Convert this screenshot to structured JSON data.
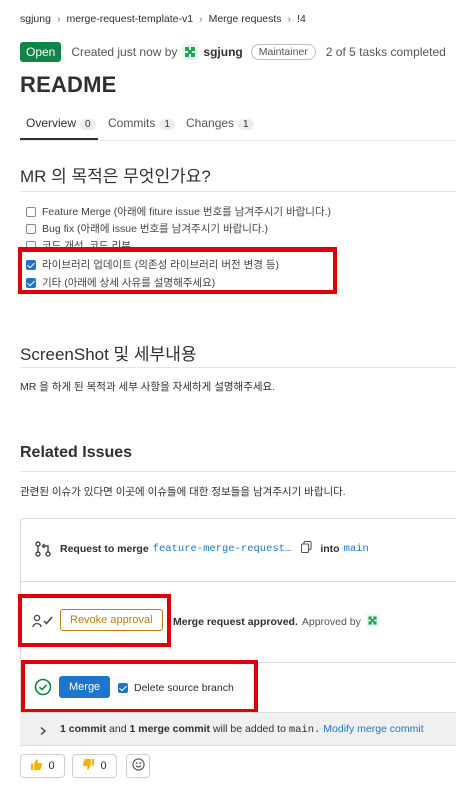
{
  "breadcrumb": {
    "items": [
      "sgjung",
      "merge-request-template-v1",
      "Merge requests",
      "!4"
    ],
    "separator": "›"
  },
  "status": {
    "badge": "Open",
    "created_text": "Created just now by",
    "author": "sgjung",
    "role": "Maintainer",
    "tasks": "2 of 5 tasks completed"
  },
  "title": "README",
  "tabs": [
    {
      "label": "Overview",
      "count": "0"
    },
    {
      "label": "Commits",
      "count": "1"
    },
    {
      "label": "Changes",
      "count": "1"
    }
  ],
  "description": {
    "purpose_heading": "MR 의 목적은 무엇인가요?",
    "tasks": [
      {
        "label": "Feature Merge (아래에 fiture issue 번호를 남겨주시기 바랍니다.)",
        "checked": false
      },
      {
        "label": "Bug fix (아래에 issue 번호를 남겨주시기 바랍니다.)",
        "checked": false
      },
      {
        "label": "코드 개선, 코드 리뷰",
        "checked": false
      },
      {
        "label": "라이브러리 업데이트 (의존성 라이브러리 버전 변경 등)",
        "checked": true
      },
      {
        "label": "기타 (아래에 상세 사유를 설명해주세요)",
        "checked": true
      }
    ],
    "screenshot_heading": "ScreenShot 및 세부내용",
    "screenshot_text": "MR 을 하게 된 목적과 세부 사항을 자세하게 설명해주세요.",
    "related_heading": "Related Issues",
    "related_text": "관련된 이슈가 있다면 이곳에 이슈들에 대한 정보들을 남겨주시기 바랍니다."
  },
  "merge_widget": {
    "request_label": "Request to merge",
    "source_branch": "feature-merge-request…",
    "into_label": "into",
    "target_branch": "main",
    "approval_title": "Merge request approved.",
    "approved_by": "Approved by",
    "revoke_label": "Revoke approval",
    "merge_label": "Merge",
    "delete_source_label": "Delete source branch",
    "delete_source_checked": true,
    "commits_count": "1 commit",
    "commits_and": "and",
    "merge_commit_count": "1 merge commit",
    "commits_suffix": "will be added to",
    "commits_target": "main.",
    "modify_link": "Modify merge commit"
  },
  "reactions": {
    "thumbs_up_count": "0",
    "thumbs_down_count": "0"
  },
  "colors": {
    "open": "#108548",
    "link": "#1f75cb",
    "highlight": "#e0000a",
    "revoke": "#c17d10"
  }
}
